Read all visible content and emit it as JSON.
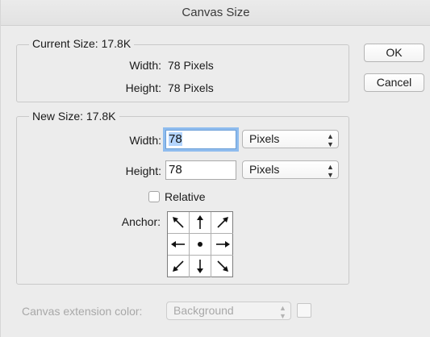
{
  "window": {
    "title": "Canvas Size"
  },
  "current_size": {
    "legend": "Current Size: 17.8K",
    "width_label": "Width:",
    "width_value": "78 Pixels",
    "height_label": "Height:",
    "height_value": "78 Pixels"
  },
  "new_size": {
    "legend": "New Size: 17.8K",
    "width_label": "Width:",
    "width_value": "78",
    "width_unit": "Pixels",
    "height_label": "Height:",
    "height_value": "78",
    "height_unit": "Pixels",
    "relative_label": "Relative",
    "relative_checked": false,
    "anchor_label": "Anchor:",
    "anchor_icons": [
      "arrow-up-left-icon",
      "arrow-up-icon",
      "arrow-up-right-icon",
      "arrow-left-icon",
      "anchor-center-dot-icon",
      "arrow-right-icon",
      "arrow-down-left-icon",
      "arrow-down-icon",
      "arrow-down-right-icon"
    ]
  },
  "buttons": {
    "ok_label": "OK",
    "cancel_label": "Cancel"
  },
  "extension": {
    "label": "Canvas extension color:",
    "value": "Background",
    "enabled": false
  },
  "colors": {
    "dialog_bg": "#ececec",
    "focus_ring": "#8fbcee",
    "text_selection": "#b4d5fe",
    "disabled_text": "#a8a8a8"
  }
}
